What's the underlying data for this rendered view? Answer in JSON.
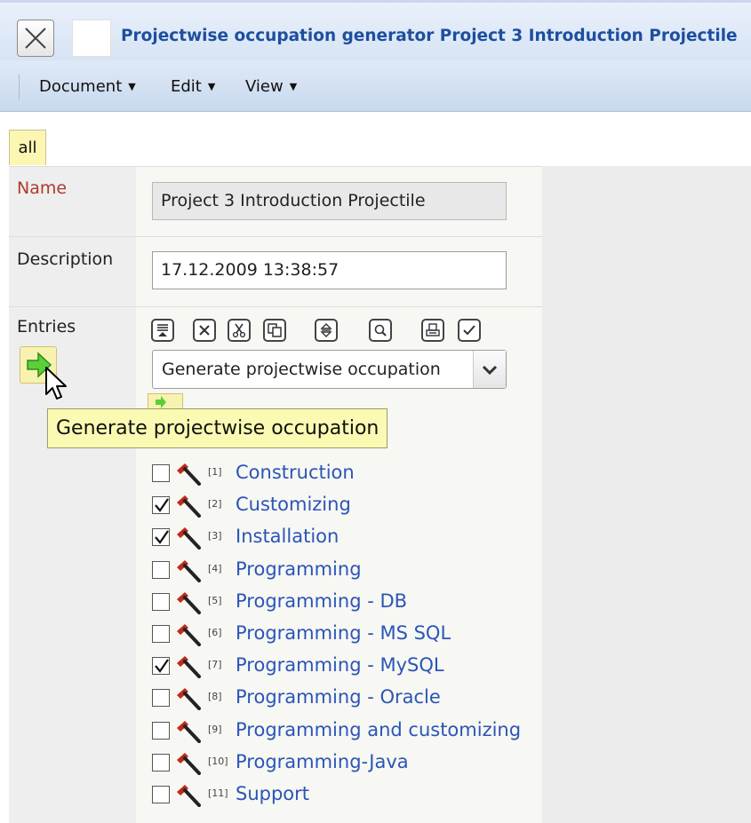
{
  "window": {
    "title": "Projectwise occupation generator Project 3 Introduction Projectile"
  },
  "menu": [
    {
      "label": "Document"
    },
    {
      "label": "Edit"
    },
    {
      "label": "View"
    }
  ],
  "tabs": [
    {
      "label": "all"
    }
  ],
  "form": {
    "name_label": "Name",
    "name_value": "Project 3 Introduction Projectile",
    "description_label": "Description",
    "description_value": "17.12.2009 13:38:57",
    "entries_label": "Entries",
    "action_select_value": "Generate projectwise occupation",
    "tooltip": "Generate projectwise occupation"
  },
  "toolbar_icons": [
    "details-icon",
    "remove-icon",
    "cut-icon",
    "copy-icon",
    "sort-icon",
    "search-icon",
    "print-icon",
    "check-icon"
  ],
  "entries": [
    {
      "index": "[1]",
      "label": "Construction",
      "checked": false
    },
    {
      "index": "[2]",
      "label": "Customizing",
      "checked": true
    },
    {
      "index": "[3]",
      "label": "Installation",
      "checked": true
    },
    {
      "index": "[4]",
      "label": "Programming",
      "checked": false
    },
    {
      "index": "[5]",
      "label": "Programming - DB",
      "checked": false
    },
    {
      "index": "[6]",
      "label": "Programming - MS SQL",
      "checked": false
    },
    {
      "index": "[7]",
      "label": "Programming - MySQL",
      "checked": true
    },
    {
      "index": "[8]",
      "label": "Programming - Oracle",
      "checked": false
    },
    {
      "index": "[9]",
      "label": "Programming and customizing",
      "checked": false
    },
    {
      "index": "[10]",
      "label": "Programming-Java",
      "checked": false
    },
    {
      "index": "[11]",
      "label": "Support",
      "checked": false
    }
  ],
  "colors": {
    "title_text": "#1d4fa0",
    "link": "#2a55b8",
    "required_label": "#b03a2e",
    "tab_active": "#fbf6b2",
    "tooltip_bg": "#fafab2"
  }
}
